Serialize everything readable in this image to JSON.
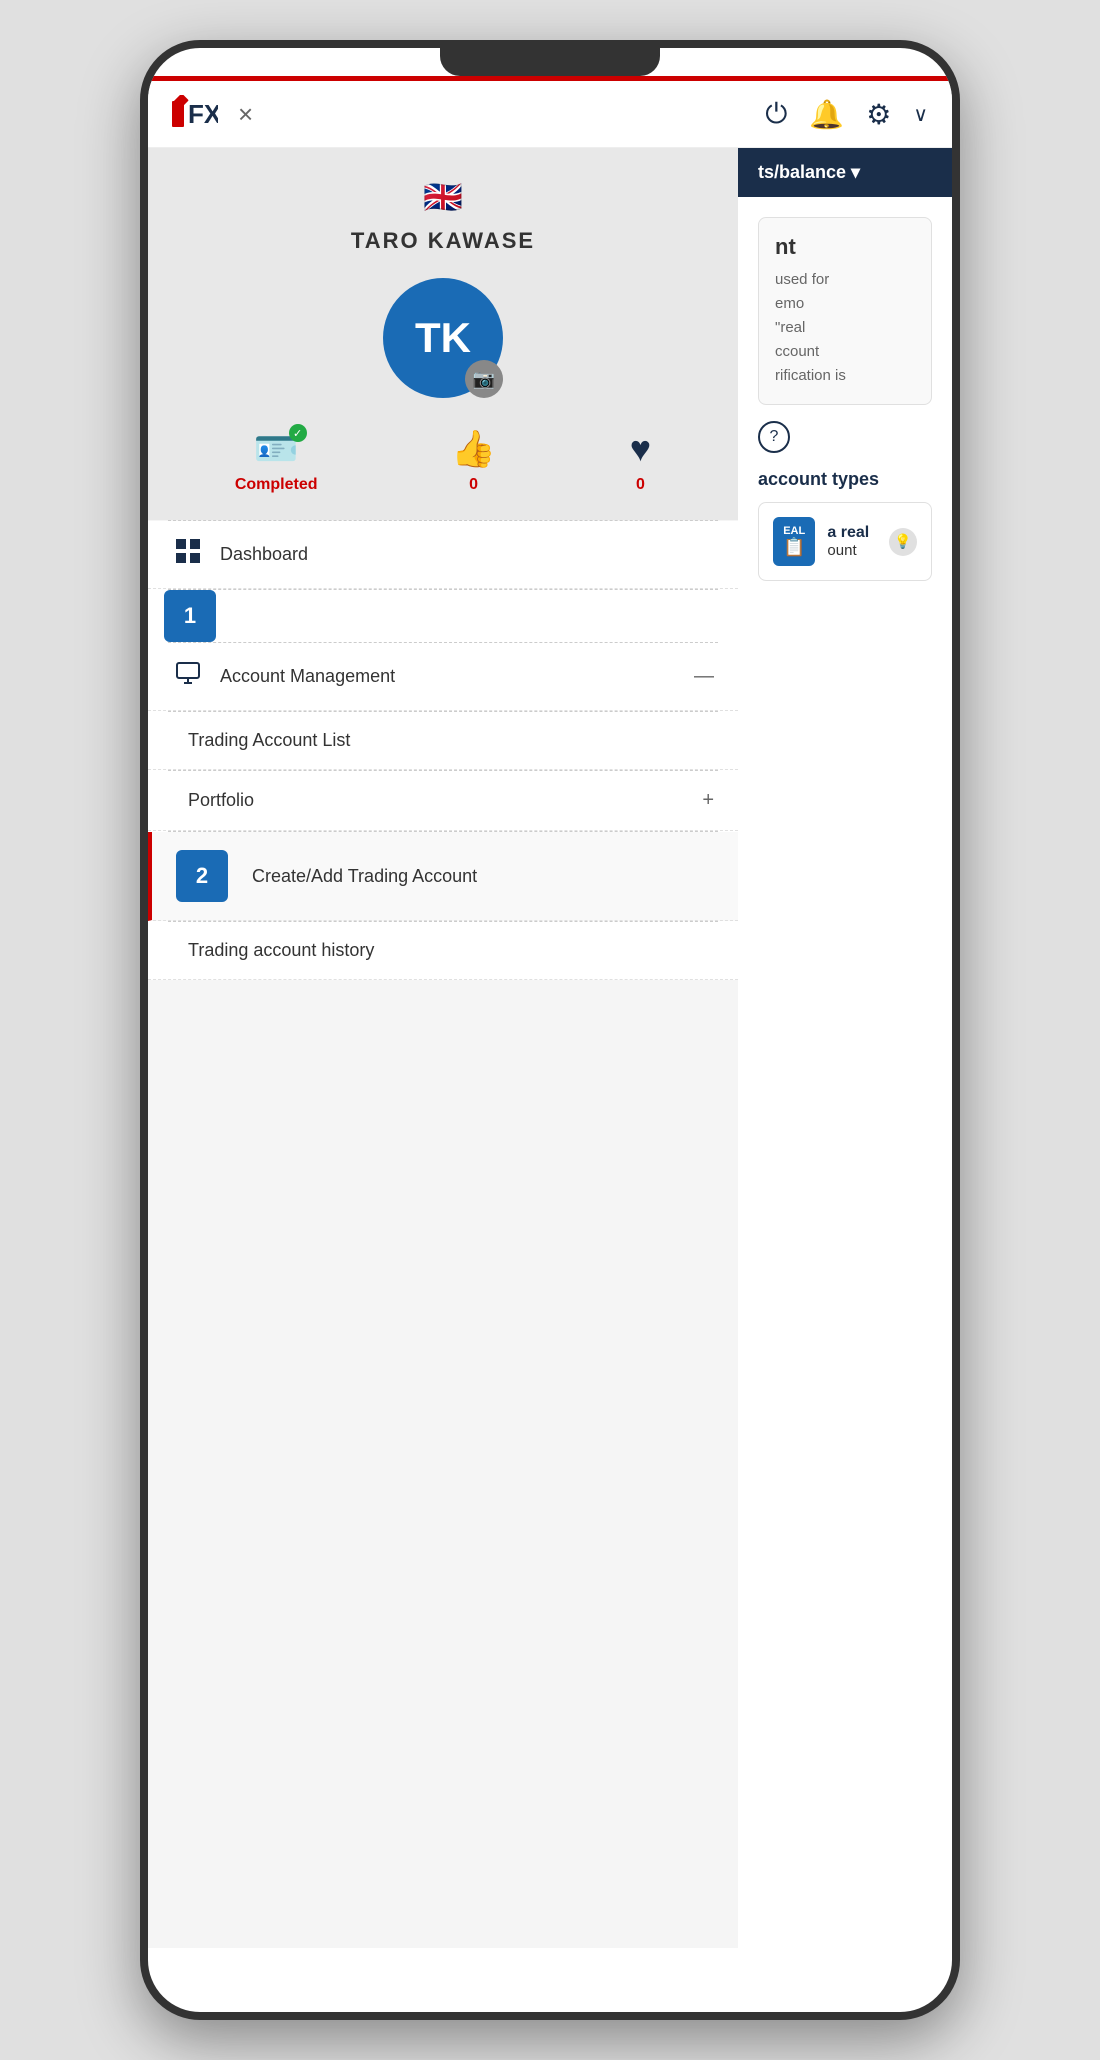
{
  "phone": {
    "header": {
      "logo_text": "FXON",
      "close_label": "×",
      "power_icon": "⏻",
      "bell_icon": "🔔",
      "gear_icon": "⚙",
      "chevron": "∨",
      "right_nav_label": "ts/balance",
      "right_nav_chevron": "▾"
    },
    "profile": {
      "flag": "🇬🇧",
      "username": "TARO KAWASE",
      "initials": "TK",
      "stats": [
        {
          "icon": "id_card",
          "label": "Completed",
          "value": null
        },
        {
          "icon": "thumbs_up",
          "label": null,
          "value": "0"
        },
        {
          "icon": "heart",
          "label": null,
          "value": "0"
        }
      ]
    },
    "nav": [
      {
        "id": "dashboard",
        "icon": "grid",
        "label": "Dashboard",
        "badge": null,
        "has_submenu": false,
        "active": false,
        "items": []
      },
      {
        "id": "account-management",
        "icon": "monitor",
        "label": "Account Management",
        "badge": null,
        "has_submenu": true,
        "expanded": true,
        "active": false,
        "items": [
          {
            "id": "trading-account-list",
            "label": "Trading Account List",
            "has_plus": false,
            "active": false
          },
          {
            "id": "portfolio",
            "label": "Portfolio",
            "has_plus": true,
            "active": false
          }
        ]
      },
      {
        "id": "create-add-trading",
        "icon": null,
        "label": "Create/Add Trading Account",
        "badge": "2",
        "has_submenu": false,
        "active": true,
        "items": []
      },
      {
        "id": "trading-account-history",
        "icon": null,
        "label": "Trading account history",
        "badge": null,
        "has_submenu": false,
        "active": false,
        "items": []
      }
    ],
    "right_panel": {
      "header_text": "ts/balance ▾",
      "section_title": "nt",
      "description_lines": [
        "used for",
        "emo",
        "\"real",
        "ccount",
        "rification is"
      ],
      "help_text": "?",
      "account_types_label": "account types",
      "account_card": {
        "badge_line1": "EAL",
        "badge_icon": "📋",
        "text1": "a real",
        "text2": "ount"
      }
    }
  }
}
